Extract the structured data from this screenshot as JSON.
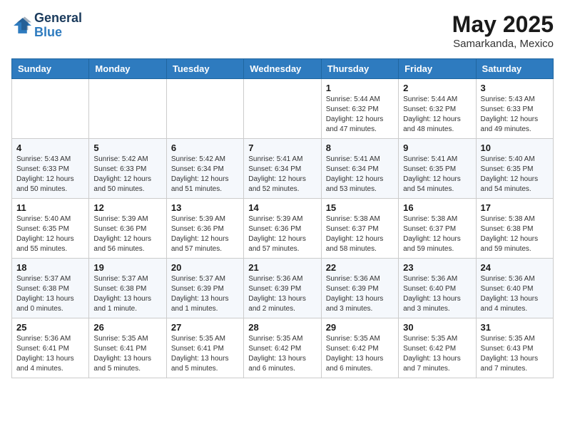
{
  "logo": {
    "line1": "General",
    "line2": "Blue"
  },
  "title": "May 2025",
  "subtitle": "Samarkanda, Mexico",
  "weekdays": [
    "Sunday",
    "Monday",
    "Tuesday",
    "Wednesday",
    "Thursday",
    "Friday",
    "Saturday"
  ],
  "weeks": [
    [
      {
        "day": "",
        "info": ""
      },
      {
        "day": "",
        "info": ""
      },
      {
        "day": "",
        "info": ""
      },
      {
        "day": "",
        "info": ""
      },
      {
        "day": "1",
        "info": "Sunrise: 5:44 AM\nSunset: 6:32 PM\nDaylight: 12 hours\nand 47 minutes."
      },
      {
        "day": "2",
        "info": "Sunrise: 5:44 AM\nSunset: 6:32 PM\nDaylight: 12 hours\nand 48 minutes."
      },
      {
        "day": "3",
        "info": "Sunrise: 5:43 AM\nSunset: 6:33 PM\nDaylight: 12 hours\nand 49 minutes."
      }
    ],
    [
      {
        "day": "4",
        "info": "Sunrise: 5:43 AM\nSunset: 6:33 PM\nDaylight: 12 hours\nand 50 minutes."
      },
      {
        "day": "5",
        "info": "Sunrise: 5:42 AM\nSunset: 6:33 PM\nDaylight: 12 hours\nand 50 minutes."
      },
      {
        "day": "6",
        "info": "Sunrise: 5:42 AM\nSunset: 6:34 PM\nDaylight: 12 hours\nand 51 minutes."
      },
      {
        "day": "7",
        "info": "Sunrise: 5:41 AM\nSunset: 6:34 PM\nDaylight: 12 hours\nand 52 minutes."
      },
      {
        "day": "8",
        "info": "Sunrise: 5:41 AM\nSunset: 6:34 PM\nDaylight: 12 hours\nand 53 minutes."
      },
      {
        "day": "9",
        "info": "Sunrise: 5:41 AM\nSunset: 6:35 PM\nDaylight: 12 hours\nand 54 minutes."
      },
      {
        "day": "10",
        "info": "Sunrise: 5:40 AM\nSunset: 6:35 PM\nDaylight: 12 hours\nand 54 minutes."
      }
    ],
    [
      {
        "day": "11",
        "info": "Sunrise: 5:40 AM\nSunset: 6:35 PM\nDaylight: 12 hours\nand 55 minutes."
      },
      {
        "day": "12",
        "info": "Sunrise: 5:39 AM\nSunset: 6:36 PM\nDaylight: 12 hours\nand 56 minutes."
      },
      {
        "day": "13",
        "info": "Sunrise: 5:39 AM\nSunset: 6:36 PM\nDaylight: 12 hours\nand 57 minutes."
      },
      {
        "day": "14",
        "info": "Sunrise: 5:39 AM\nSunset: 6:36 PM\nDaylight: 12 hours\nand 57 minutes."
      },
      {
        "day": "15",
        "info": "Sunrise: 5:38 AM\nSunset: 6:37 PM\nDaylight: 12 hours\nand 58 minutes."
      },
      {
        "day": "16",
        "info": "Sunrise: 5:38 AM\nSunset: 6:37 PM\nDaylight: 12 hours\nand 59 minutes."
      },
      {
        "day": "17",
        "info": "Sunrise: 5:38 AM\nSunset: 6:38 PM\nDaylight: 12 hours\nand 59 minutes."
      }
    ],
    [
      {
        "day": "18",
        "info": "Sunrise: 5:37 AM\nSunset: 6:38 PM\nDaylight: 13 hours\nand 0 minutes."
      },
      {
        "day": "19",
        "info": "Sunrise: 5:37 AM\nSunset: 6:38 PM\nDaylight: 13 hours\nand 1 minute."
      },
      {
        "day": "20",
        "info": "Sunrise: 5:37 AM\nSunset: 6:39 PM\nDaylight: 13 hours\nand 1 minutes."
      },
      {
        "day": "21",
        "info": "Sunrise: 5:36 AM\nSunset: 6:39 PM\nDaylight: 13 hours\nand 2 minutes."
      },
      {
        "day": "22",
        "info": "Sunrise: 5:36 AM\nSunset: 6:39 PM\nDaylight: 13 hours\nand 3 minutes."
      },
      {
        "day": "23",
        "info": "Sunrise: 5:36 AM\nSunset: 6:40 PM\nDaylight: 13 hours\nand 3 minutes."
      },
      {
        "day": "24",
        "info": "Sunrise: 5:36 AM\nSunset: 6:40 PM\nDaylight: 13 hours\nand 4 minutes."
      }
    ],
    [
      {
        "day": "25",
        "info": "Sunrise: 5:36 AM\nSunset: 6:41 PM\nDaylight: 13 hours\nand 4 minutes."
      },
      {
        "day": "26",
        "info": "Sunrise: 5:35 AM\nSunset: 6:41 PM\nDaylight: 13 hours\nand 5 minutes."
      },
      {
        "day": "27",
        "info": "Sunrise: 5:35 AM\nSunset: 6:41 PM\nDaylight: 13 hours\nand 5 minutes."
      },
      {
        "day": "28",
        "info": "Sunrise: 5:35 AM\nSunset: 6:42 PM\nDaylight: 13 hours\nand 6 minutes."
      },
      {
        "day": "29",
        "info": "Sunrise: 5:35 AM\nSunset: 6:42 PM\nDaylight: 13 hours\nand 6 minutes."
      },
      {
        "day": "30",
        "info": "Sunrise: 5:35 AM\nSunset: 6:42 PM\nDaylight: 13 hours\nand 7 minutes."
      },
      {
        "day": "31",
        "info": "Sunrise: 5:35 AM\nSunset: 6:43 PM\nDaylight: 13 hours\nand 7 minutes."
      }
    ]
  ]
}
